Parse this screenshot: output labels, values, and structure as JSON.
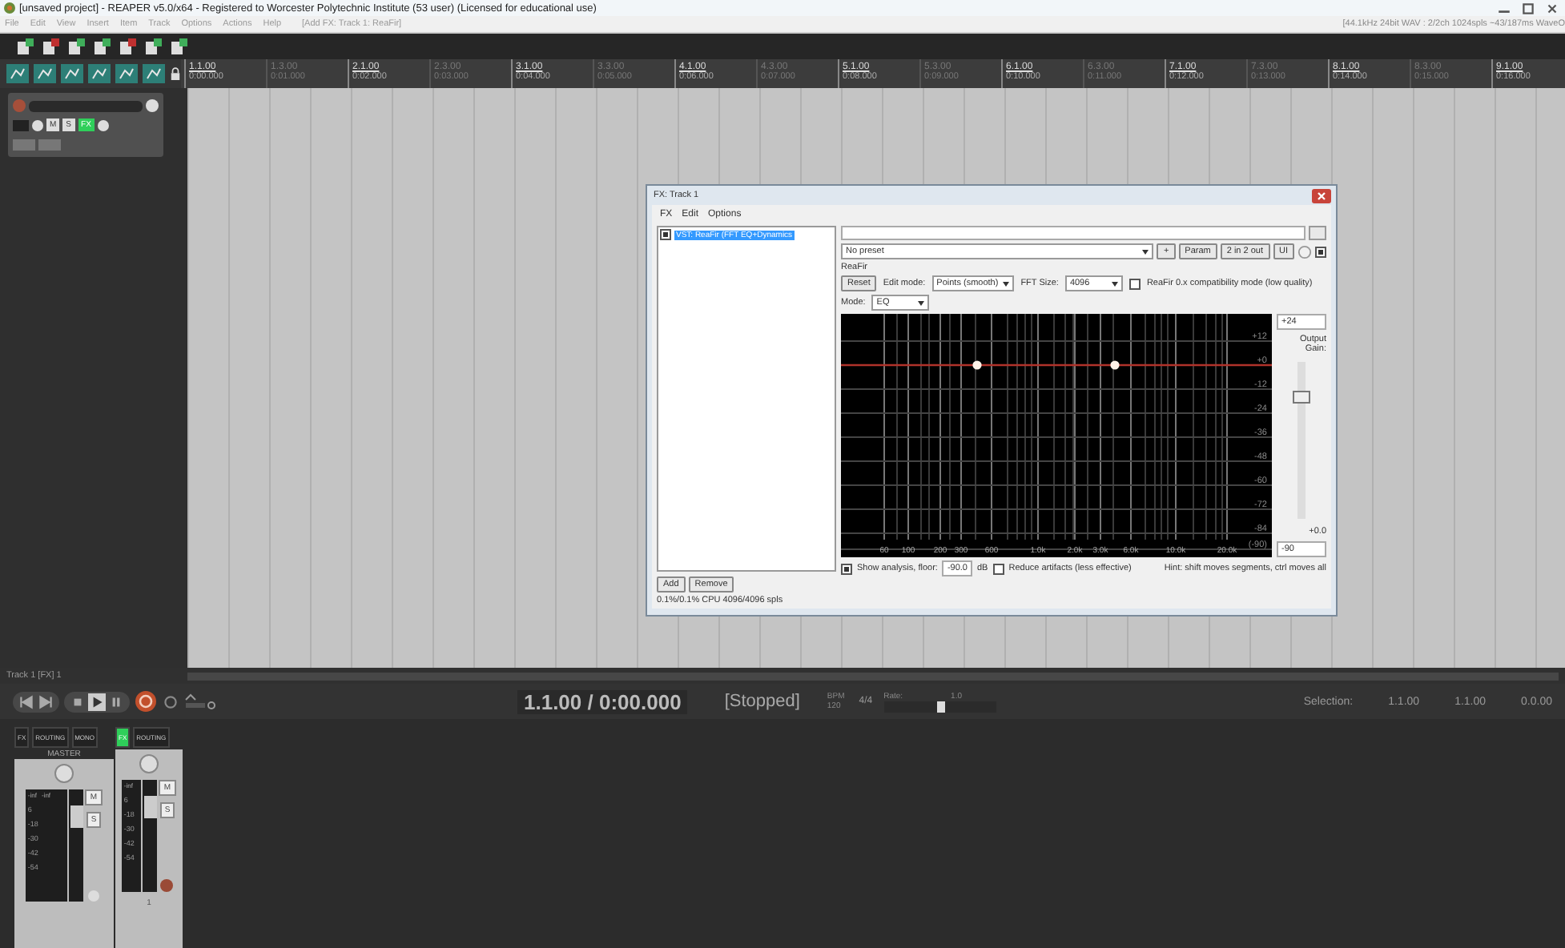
{
  "window": {
    "title": "[unsaved project] - REAPER v5.0/x64 - Registered to Worcester Polytechnic Institute (53 user) (Licensed for educational use)"
  },
  "menu": [
    "File",
    "Edit",
    "View",
    "Insert",
    "Item",
    "Track",
    "Options",
    "Actions",
    "Help"
  ],
  "menu_note": "[Add FX: Track 1: ReaFir]",
  "status": "[44.1kHz 24bit WAV : 2/2ch 1024spls ~43/187ms WaveO",
  "ruler": [
    {
      "bar": "1.1.00",
      "time": "0:00.000",
      "kind": "major"
    },
    {
      "bar": "1.3.00",
      "time": "0:01.000",
      "kind": "minor"
    },
    {
      "bar": "2.1.00",
      "time": "0:02.000",
      "kind": "major"
    },
    {
      "bar": "2.3.00",
      "time": "0:03.000",
      "kind": "minor"
    },
    {
      "bar": "3.1.00",
      "time": "0:04.000",
      "kind": "major"
    },
    {
      "bar": "3.3.00",
      "time": "0:05.000",
      "kind": "minor"
    },
    {
      "bar": "4.1.00",
      "time": "0:06.000",
      "kind": "major"
    },
    {
      "bar": "4.3.00",
      "time": "0:07.000",
      "kind": "minor"
    },
    {
      "bar": "5.1.00",
      "time": "0:08.000",
      "kind": "major"
    },
    {
      "bar": "5.3.00",
      "time": "0:09.000",
      "kind": "minor"
    },
    {
      "bar": "6.1.00",
      "time": "0:10.000",
      "kind": "major"
    },
    {
      "bar": "6.3.00",
      "time": "0:11.000",
      "kind": "minor"
    },
    {
      "bar": "7.1.00",
      "time": "0:12.000",
      "kind": "major"
    },
    {
      "bar": "7.3.00",
      "time": "0:13.000",
      "kind": "minor"
    },
    {
      "bar": "8.1.00",
      "time": "0:14.000",
      "kind": "major"
    },
    {
      "bar": "8.3.00",
      "time": "0:15.000",
      "kind": "minor"
    },
    {
      "bar": "9.1.00",
      "time": "0:16.000",
      "kind": "major"
    }
  ],
  "track": {
    "mute": "M",
    "solo": "S",
    "fx": {
      "label": "FX",
      "on": true
    }
  },
  "track_label": "Track 1 [FX] 1",
  "transport": {
    "position": "1.1.00 / 0:00.000",
    "state": "[Stopped]",
    "bpm_label": "BPM",
    "bpm": "120",
    "signature": "4/4",
    "rate_label": "Rate:",
    "rate": "1.0",
    "rate_slider": {
      "level": 0.5
    },
    "selection_label": "Selection:",
    "selection": [
      "1.1.00",
      "1.1.00",
      "0.0.00"
    ],
    "playing": true
  },
  "mixer": {
    "master": {
      "label": "MASTER",
      "buttons": [
        {
          "label": "FX",
          "on": false
        },
        {
          "label": "ROUTING",
          "on": false
        },
        {
          "label": "MONO",
          "on": false
        }
      ],
      "peaks": [
        "-inf",
        "-inf"
      ],
      "scale": [
        "6",
        "-18",
        "-30",
        "-42",
        "-54"
      ],
      "mute": "M",
      "solo": "S"
    },
    "track": {
      "buttons": [
        {
          "label": "FX",
          "on": true
        },
        {
          "label": "ROUTING",
          "on": false
        }
      ],
      "peaks": [
        "-inf"
      ],
      "scale": [
        "6",
        "-18",
        "-30",
        "-42",
        "-54"
      ],
      "mute": "M",
      "solo": "S",
      "number": "1"
    }
  },
  "fx_window": {
    "title": "FX: Track 1",
    "menu": [
      "FX",
      "Edit",
      "Options"
    ],
    "chain": [
      {
        "label": "VST: ReaFir (FFT EQ+Dynamics",
        "checked": true,
        "selected": true
      }
    ],
    "add": "Add",
    "remove": "Remove",
    "cpu": "0.1%/0.1% CPU 4096/4096 spls",
    "preset": "No preset",
    "enabled": true,
    "preset_buttons": [
      "+",
      "Param",
      "2 in 2 out",
      "UI"
    ],
    "plugin_name": "ReaFir",
    "reset": "Reset",
    "edit_mode_label": "Edit mode:",
    "edit_mode": "Points (smooth)",
    "fft_label": "FFT Size:",
    "fft": "4096",
    "compat": {
      "label": "ReaFir 0.x compatibility mode (low quality)",
      "checked": false
    },
    "mode_label": "Mode:",
    "mode": "EQ",
    "graph": {
      "y_labels": [
        "+12",
        "+0",
        "-12",
        "-24",
        "-36",
        "-48",
        "-60",
        "-72",
        "-84",
        "(-90)"
      ],
      "x_labels": [
        "60",
        "100",
        "200",
        "300",
        "600",
        "1.0k",
        "2.0k",
        "3.0k",
        "6.0k",
        "10.0k",
        "20.0k"
      ]
    },
    "max_field": "+24",
    "gain_label": "Output Gain:",
    "gain_value": "+0.0",
    "gain_slider": {
      "level": 0.79
    },
    "min_field": "-90",
    "analysis": {
      "label": "Show analysis, floor:",
      "checked": true
    },
    "floor": "-90.0",
    "floor_unit": "dB",
    "reduce": {
      "label": "Reduce artifacts (less effective)",
      "checked": false
    },
    "hint": "Hint: shift moves segments, ctrl moves all"
  }
}
